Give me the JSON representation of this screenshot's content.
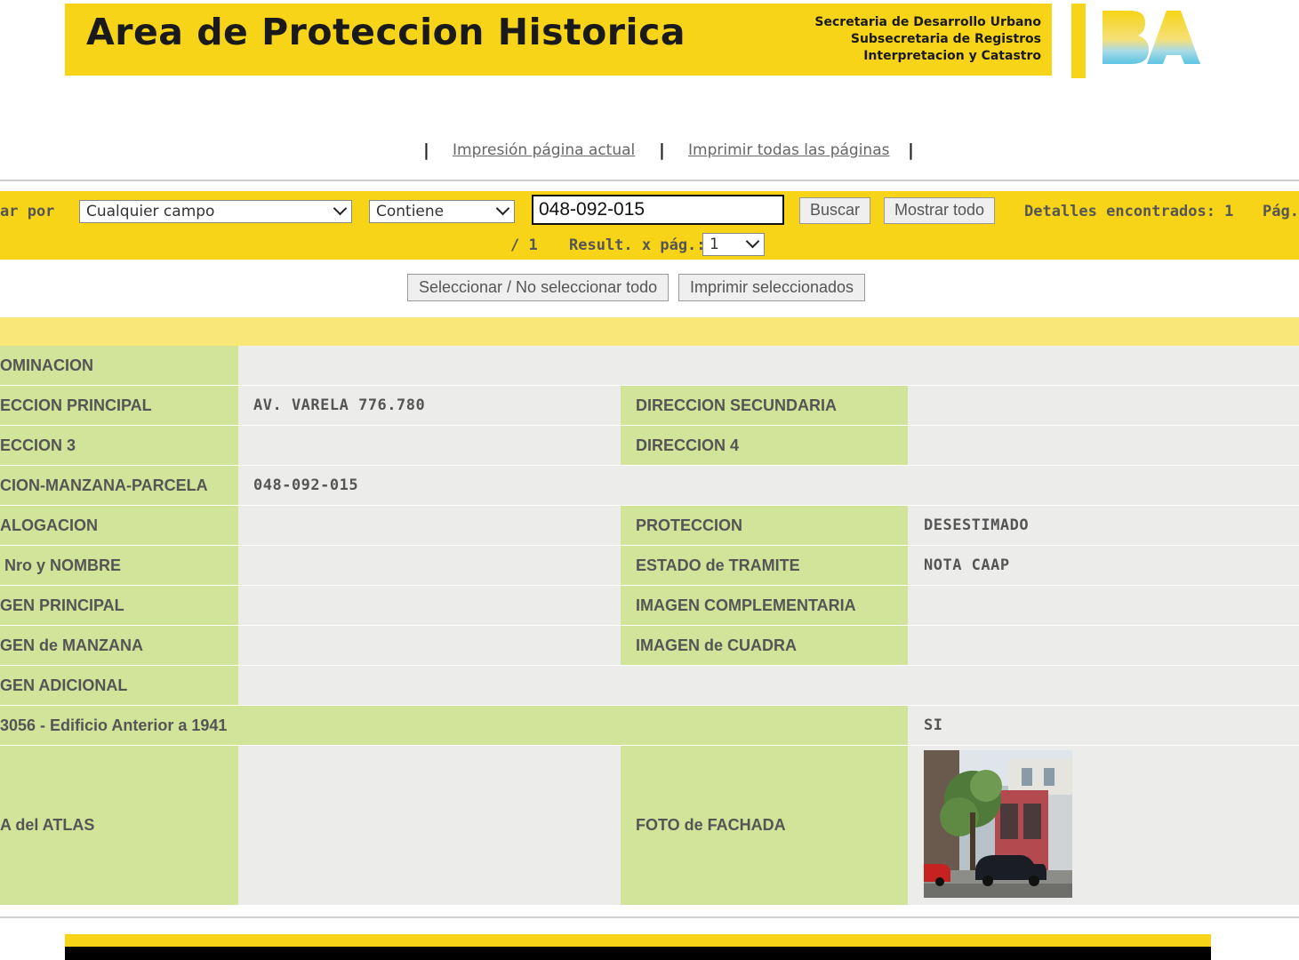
{
  "header": {
    "title": "Area de Proteccion Historica",
    "org_lines": [
      "Secretaria de Desarrollo Urbano",
      "Subsecretaria de Registros",
      "Interpretacion y Catastro"
    ],
    "logo_text": "BA"
  },
  "print_links": {
    "current_page": "Impresión página actual",
    "all_pages": "Imprimir todas las páginas"
  },
  "search": {
    "label": "ar por",
    "field_select": "Cualquier campo",
    "operator_select": "Contiene",
    "query_value": "048-092-015",
    "search_button": "Buscar",
    "show_all_button": "Mostrar todo",
    "details_found": "Detalles encontrados: 1",
    "page_label": "Pág.",
    "page_total": "/ 1",
    "results_per_page_label": "Result. x pág.:",
    "results_per_page_value": "1"
  },
  "actions": {
    "select_all_button": "Seleccionar / No seleccionar todo",
    "print_selected_button": "Imprimir seleccionados"
  },
  "details": {
    "denominacion_label": "OMINACION",
    "dir_principal_label": "ECCION PRINCIPAL",
    "dir_principal_value": "AV. VARELA 776.780",
    "dir_secundaria_label": "DIRECCION SECUNDARIA",
    "dir3_label": "ECCION 3",
    "dir4_label": "DIRECCION 4",
    "smp_label": "CION-MANZANA-PARCELA",
    "smp_value": "048-092-015",
    "catalogacion_label": "ALOGACION",
    "proteccion_label": "PROTECCION",
    "proteccion_value": "DESESTIMADO",
    "nro_nombre_label": " Nro y NOMBRE",
    "estado_tramite_label": "ESTADO de TRAMITE",
    "estado_tramite_value": "NOTA CAAP",
    "img_principal_label": "GEN PRINCIPAL",
    "img_complementaria_label": "IMAGEN COMPLEMENTARIA",
    "img_manzana_label": "GEN de MANZANA",
    "img_cuadra_label": "IMAGEN de CUADRA",
    "img_adicional_label": "GEN ADICIONAL",
    "edificio_label": "3056 - Edificio Anterior a 1941",
    "edificio_value": "SI",
    "atlas_label": "A del ATLAS",
    "foto_fachada_label": "FOTO de FACHADA"
  },
  "colors": {
    "brand_yellow": "#f7d417",
    "label_green": "#d1e49a",
    "value_gray": "#ececea",
    "strip_yellow": "#f9e877"
  }
}
